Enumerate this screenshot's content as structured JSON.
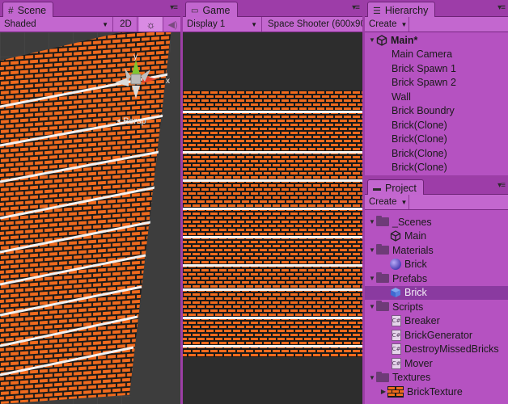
{
  "scene": {
    "tab_label": "Scene",
    "shading_mode": "Shaded",
    "mode_2d": "2D",
    "persp_label": "Persp",
    "gizmo_axes": {
      "y": "y",
      "x": "x"
    }
  },
  "game": {
    "tab_label": "Game",
    "display": "Display 1",
    "aspect": "Space Shooter (600x90"
  },
  "hierarchy": {
    "tab_label": "Hierarchy",
    "create_label": "Create",
    "scene_name": "Main*",
    "items": [
      "Main Camera",
      "Brick Spawn 1",
      "Brick Spawn 2",
      "Wall",
      "Brick Boundry",
      "Brick(Clone)",
      "Brick(Clone)",
      "Brick(Clone)",
      "Brick(Clone)"
    ]
  },
  "project": {
    "tab_label": "Project",
    "create_label": "Create",
    "tree": [
      {
        "label": "_Scenes",
        "kind": "folder",
        "depth": 0,
        "expanded": true
      },
      {
        "label": "Main",
        "kind": "scene",
        "depth": 1
      },
      {
        "label": "Materials",
        "kind": "folder",
        "depth": 0,
        "expanded": true
      },
      {
        "label": "Brick",
        "kind": "material",
        "depth": 1
      },
      {
        "label": "Prefabs",
        "kind": "folder",
        "depth": 0,
        "expanded": true
      },
      {
        "label": "Brick",
        "kind": "prefab",
        "depth": 1,
        "selected": true
      },
      {
        "label": "Scripts",
        "kind": "folder",
        "depth": 0,
        "expanded": true
      },
      {
        "label": "Breaker",
        "kind": "script",
        "depth": 1
      },
      {
        "label": "BrickGenerator",
        "kind": "script",
        "depth": 1
      },
      {
        "label": "DestroyMissedBricks",
        "kind": "script",
        "depth": 1
      },
      {
        "label": "Mover",
        "kind": "script",
        "depth": 1
      },
      {
        "label": "Textures",
        "kind": "folder",
        "depth": 0,
        "expanded": true
      },
      {
        "label": "BrickTexture",
        "kind": "texture",
        "depth": 1,
        "collapsed_child": true
      }
    ]
  },
  "colors": {
    "panel_bg": "#b552c1",
    "selection": "#8a3aa0",
    "brick": "#f06a1d",
    "mortar": "#1a1a1a",
    "brick_band": "#f2f2f2",
    "viewport_bg": "#3a3a3a"
  }
}
